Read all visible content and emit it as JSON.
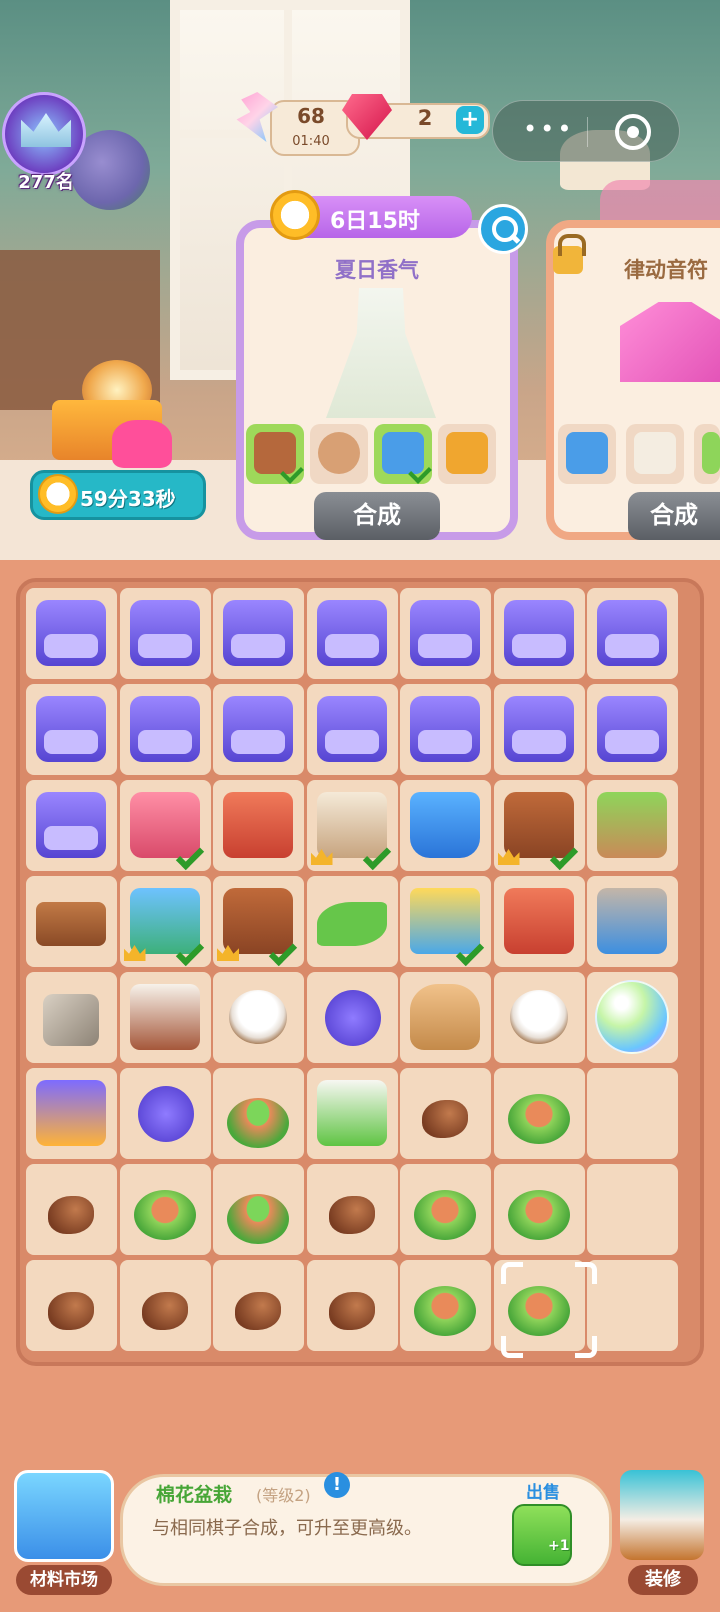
{
  "hud": {
    "rank_label": "277名",
    "energy": {
      "value": "68",
      "timer": "01:40"
    },
    "gems": {
      "value": "2",
      "add_label": "+"
    },
    "menu_dots": "•••"
  },
  "gift": {
    "countdown": "59分33秒"
  },
  "orders": [
    {
      "timer": "6日15时",
      "title": "夏日香气",
      "merge_label": "合成",
      "requirements": [
        {
          "item": "leather-bag",
          "done": true
        },
        {
          "item": "wood-rolls",
          "done": false
        },
        {
          "item": "fabric-stack",
          "done": true
        },
        {
          "item": "sewing-machine",
          "done": false
        }
      ]
    },
    {
      "title": "律动音符",
      "merge_label": "合成",
      "locked": true,
      "requirements": [
        {
          "item": "fabric-stack",
          "done": false
        },
        {
          "item": "towels",
          "done": false
        },
        {
          "item": "plant",
          "done": false
        }
      ]
    }
  ],
  "board": {
    "rows": [
      [
        "kit",
        "kit",
        "kit",
        "kit",
        "kit",
        "kit",
        "kit"
      ],
      [
        "kit",
        "kit",
        "kit",
        "kit",
        "kit",
        "kit",
        "kit"
      ],
      [
        "kit",
        "mixer",
        "basket",
        "towels",
        "bucket",
        "bag",
        "pot"
      ],
      [
        "wood",
        "cloth",
        "bag",
        "leaf",
        "gold",
        "basket",
        "cart"
      ],
      [
        "stone",
        "box",
        "cotton",
        "yarn",
        "sack",
        "cotton",
        "bubble"
      ],
      [
        "sew",
        "yarn",
        "seedling",
        "tray",
        "seed",
        "sprout",
        ""
      ],
      [
        "seed",
        "sprout",
        "seedling",
        "seed",
        "sprout",
        "sprout",
        ""
      ],
      [
        "seed",
        "seed",
        "seed",
        "seed",
        "sprout",
        "sprout",
        ""
      ]
    ],
    "checks": [
      [
        2,
        1
      ],
      [
        2,
        3
      ],
      [
        2,
        5
      ],
      [
        3,
        1
      ],
      [
        3,
        2
      ],
      [
        3,
        4
      ]
    ],
    "crowns": [
      [
        2,
        3
      ],
      [
        2,
        5
      ],
      [
        3,
        1
      ],
      [
        3,
        2
      ]
    ],
    "selected": [
      7,
      5
    ]
  },
  "info": {
    "title": "棉花盆栽",
    "level": "(等级2)",
    "help": "!",
    "description": "与相同棋子合成，可升至更高级。",
    "sell_label": "出售",
    "sell_value": "+1"
  },
  "bottom": {
    "market_label": "材料市场",
    "decor_label": "装修"
  },
  "colors": {
    "board": "#d98a69",
    "cell": "#f3d9bf",
    "accent_green": "#47a637",
    "accent_blue": "#2a8fe0"
  }
}
